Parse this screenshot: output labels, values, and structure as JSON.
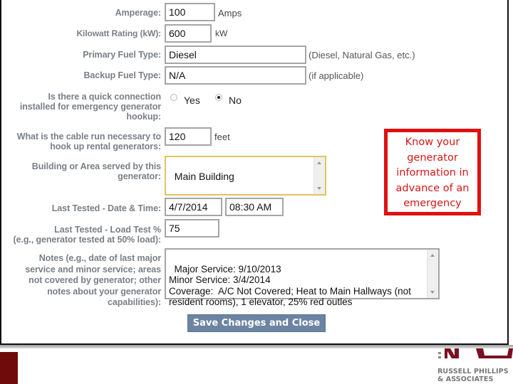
{
  "form": {
    "amperage": {
      "label": "Amperage:",
      "value": "100",
      "unit": "Amps"
    },
    "kilowatt": {
      "label": "Kilowatt Rating (kW):",
      "value": "600",
      "unit": "kW"
    },
    "primary_fuel": {
      "label": "Primary Fuel Type:",
      "value": "Diesel",
      "hint": "(Diesel, Natural Gas, etc.)"
    },
    "backup_fuel": {
      "label": "Backup Fuel Type:",
      "value": "N/A",
      "hint": "(if applicable)"
    },
    "quick_connection": {
      "label_lines": [
        "Is there a quick connection",
        "installed for emergency generator",
        "hookup:"
      ],
      "options": [
        {
          "label": "Yes",
          "selected": false
        },
        {
          "label": "No",
          "selected": true
        }
      ]
    },
    "cable_run": {
      "label_lines": [
        "What is the cable run necessary to",
        "hook up rental generators:"
      ],
      "value": "120",
      "unit": "feet"
    },
    "building_area": {
      "label_lines": [
        "Building or Area served by this",
        "generator:"
      ],
      "value": "Main Building"
    },
    "last_tested": {
      "label": "Last Tested - Date & Time:",
      "date": "4/7/2014",
      "time": "08:30 AM"
    },
    "load_test": {
      "label_lines": [
        "Last Tested - Load Test %",
        "(e.g., generator tested at 50% load):"
      ],
      "value": "75"
    },
    "notes": {
      "label_lines": [
        "Notes (e.g., date of last major",
        "service and minor service; areas",
        "not covered by generator; other",
        "notes about your generator",
        "capabilities):"
      ],
      "value": "Major Service: 9/10/2013\nMinor Service: 3/4/2014\nCoverage:  A/C Not Covered; Heat to Main Hallways (not resident rooms), 1 elevator, 25% red outles"
    },
    "save_button": "Save Changes and Close"
  },
  "callout": {
    "lines": [
      "Know your",
      "generator",
      "information in",
      "advance of an",
      "emergency"
    ],
    "color": "#e01010"
  },
  "footer": {
    "logo_line1": "RUSSELL PHILLIPS",
    "logo_line2": "& ASSOCIATES",
    "brand_color": "#7a1020"
  }
}
